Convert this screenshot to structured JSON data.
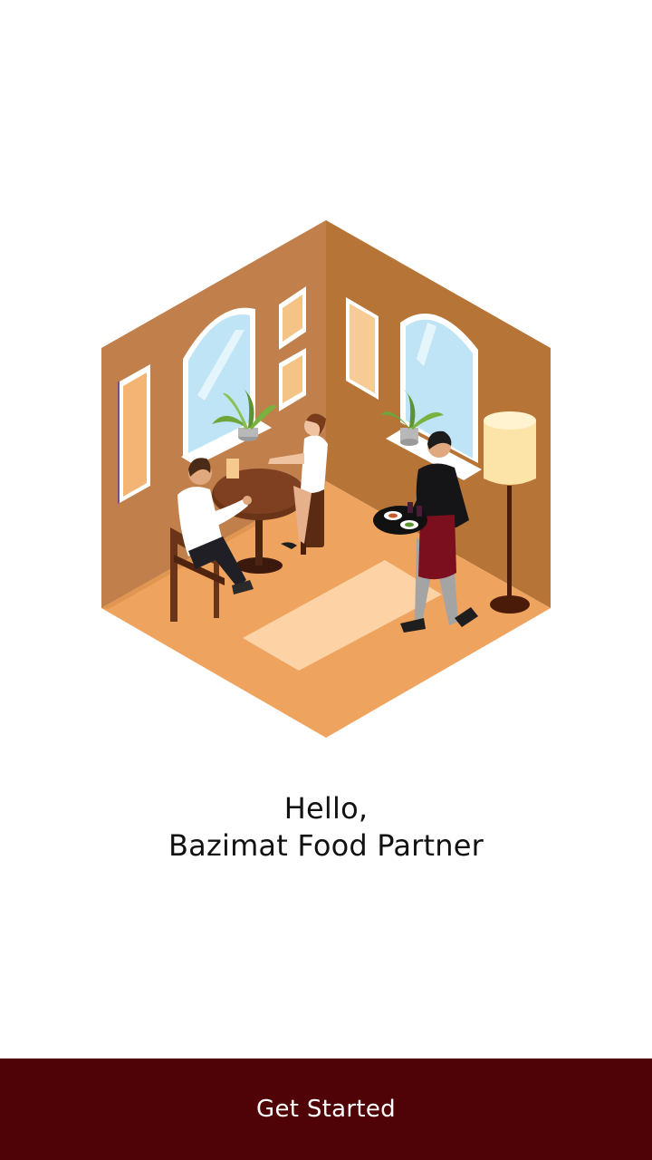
{
  "welcome": {
    "greeting_line1": "Hello,",
    "greeting_line2": "Bazimat Food Partner"
  },
  "illustration": {
    "subject": "isometric-restaurant-room"
  },
  "actions": {
    "get_started_label": "Get Started"
  },
  "colors": {
    "primary": "#500306",
    "background": "#ffffff",
    "text": "#111111",
    "wall_left": "#C17F4B",
    "wall_right": "#B67436",
    "floor": "#EEA35E"
  }
}
